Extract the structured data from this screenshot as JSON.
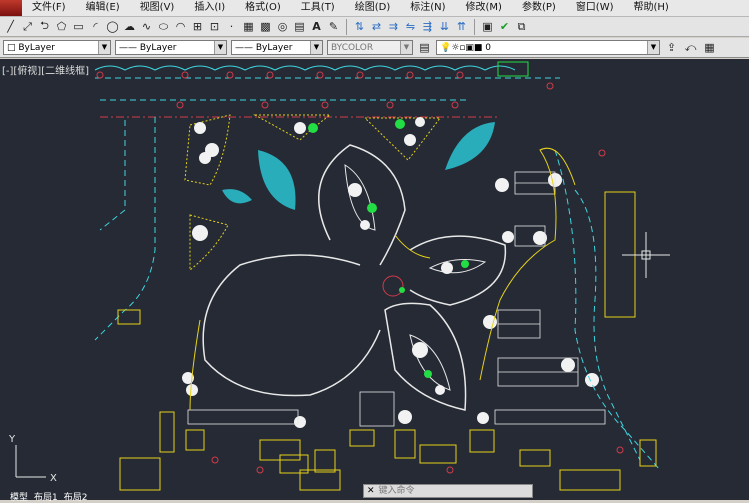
{
  "menu": [
    "文件(F)",
    "编辑(E)",
    "视图(V)",
    "插入(I)",
    "格式(O)",
    "工具(T)",
    "绘图(D)",
    "标注(N)",
    "修改(M)",
    "参数(P)",
    "窗口(W)",
    "帮助(H)"
  ],
  "properties": {
    "layer_color": "ByLayer",
    "linetype": "ByLayer",
    "lineweight": "ByLayer",
    "plotstyle": "BYCOLOR",
    "layer_name": "0"
  },
  "viewport_label": "[-][俯视][二维线框]",
  "command": {
    "prompt_icon": "✕",
    "placeholder": "键入命令"
  },
  "tabs": [
    "模型",
    "布局1",
    "布局2"
  ],
  "ucs": {
    "y": "Y",
    "x": "X"
  },
  "colors": {
    "canvas": "#252a34",
    "cyan": "#3dd6e0",
    "yellow": "#e6d21a",
    "white": "#e8e8e8",
    "red": "#d23a4a",
    "green": "#22dd44"
  }
}
